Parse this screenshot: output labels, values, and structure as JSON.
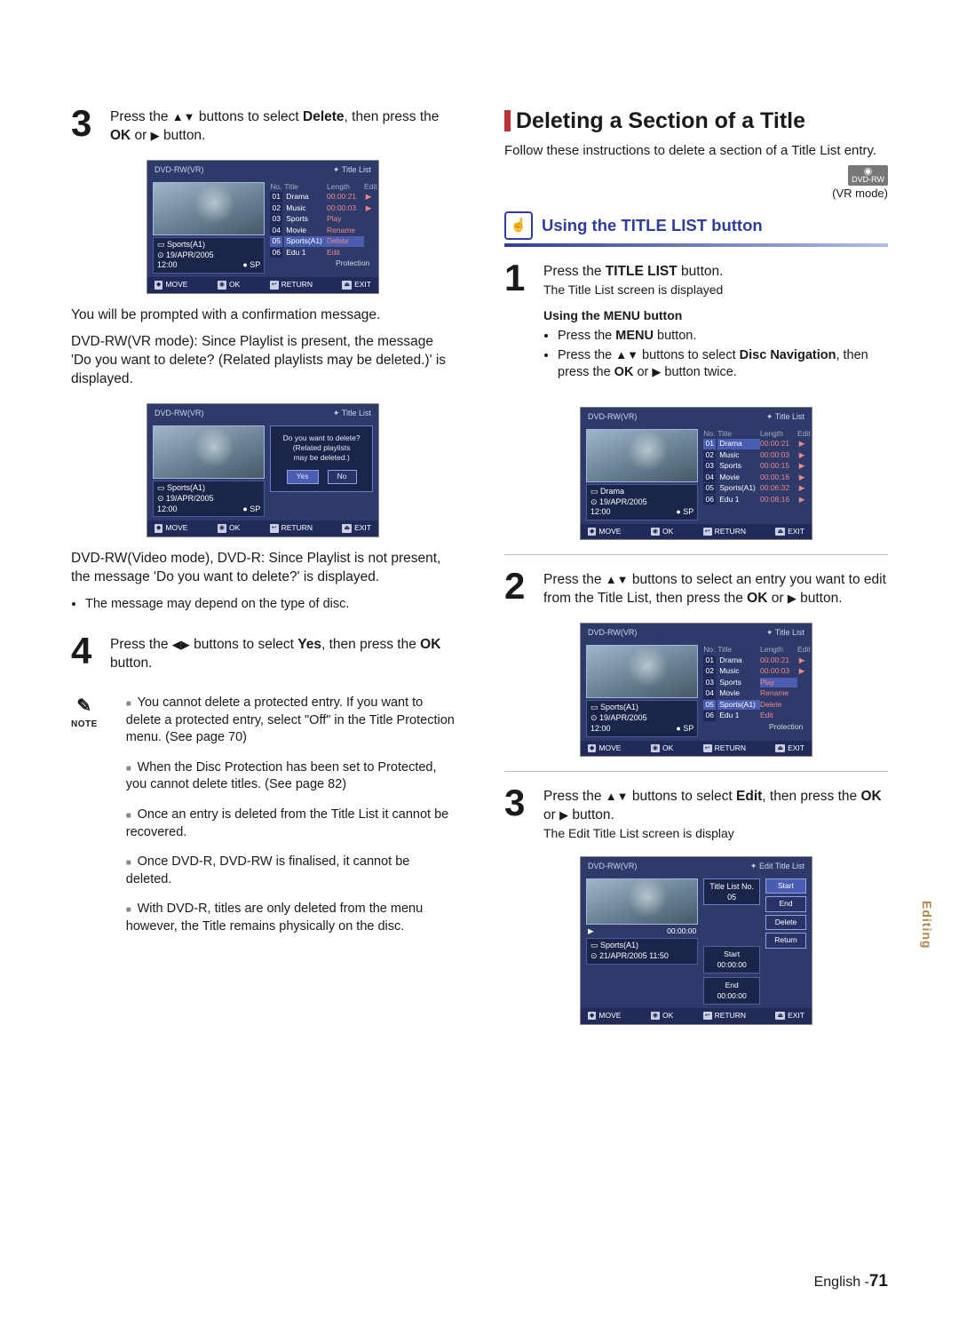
{
  "left": {
    "step3": {
      "text_a": "Press the ",
      "text_b": " buttons to select ",
      "text_bold": "Delete",
      "text_c": ", then press the ",
      "text_bold2": "OK",
      "text_d": " or ",
      "text_e": " button."
    },
    "osd1": {
      "disc": "DVD-RW(VR)",
      "title": "Title List",
      "info_name": "Sports(A1)",
      "info_date": "19/APR/2005",
      "info_time": "12:00",
      "info_sp": "SP",
      "head_no": "No.",
      "head_title": "Title",
      "head_length": "Length",
      "head_edit": "Edit",
      "rows": [
        {
          "no": "01",
          "title": "Drama",
          "len": "00:00:21",
          "edit": "▶"
        },
        {
          "no": "02",
          "title": "Music",
          "len": "00:00:03",
          "edit": "▶"
        },
        {
          "no": "03",
          "title": "Sports",
          "len": "Play",
          "edit": ""
        },
        {
          "no": "04",
          "title": "Movie",
          "len": "Rename",
          "edit": ""
        },
        {
          "no": "05",
          "title": "Sports(A1)",
          "len": "Delete",
          "edit": "",
          "sel": true,
          "lensel": true
        },
        {
          "no": "06",
          "title": "Edu 1",
          "len": "Edit",
          "edit": ""
        }
      ],
      "extra_row": "Protection",
      "footer": {
        "move": "MOVE",
        "ok": "OK",
        "return": "RETURN",
        "exit": "EXIT"
      }
    },
    "para_confirm": "You will be prompted with a confirmation message.",
    "para_vr": "DVD-RW(VR mode): Since Playlist is present, the message 'Do you want to delete? (Related playlists may be deleted.)' is displayed.",
    "osd2": {
      "disc": "DVD-RW(VR)",
      "title": "Title List",
      "info_name": "Sports(A1)",
      "info_date": "19/APR/2005",
      "info_time": "12:00",
      "info_sp": "SP",
      "confirm_line1": "Do you want to delete?",
      "confirm_line2": "(Related playlists",
      "confirm_line3": "may be deleted.)",
      "yes": "Yes",
      "no": "No",
      "footer": {
        "move": "MOVE",
        "ok": "OK",
        "return": "RETURN",
        "exit": "EXIT"
      }
    },
    "para_video": "DVD-RW(Video mode), DVD-R: Since Playlist is not present, the message 'Do you want to delete?' is displayed.",
    "bullet_msg": "The message may depend on the type of disc.",
    "step4": {
      "text_a": "Press the ",
      "text_b": " buttons to select ",
      "text_bold": "Yes",
      "text_c": ", then press the ",
      "text_bold2": "OK",
      "text_d": " button."
    },
    "note_label": "NOTE",
    "notes": [
      "You cannot delete a protected entry. If you want to delete a protected entry, select \"Off\" in the Title Protection menu. (See page 70)",
      "When the Disc Protection has been set to Protected, you cannot delete titles. (See page 82)",
      "Once an entry is deleted from the Title List it cannot be recovered.",
      "Once DVD-R, DVD-RW is finalised, it cannot be deleted.",
      "With DVD-R, titles are only deleted from the menu however, the Title remains physically on the disc."
    ]
  },
  "right": {
    "heading": "Deleting a Section of a Title",
    "sub": "Follow these instructions to delete a section of a Title List entry.",
    "mode_label": "DVD-RW",
    "mode_sub": "(VR mode)",
    "method_title": "Using the TITLE LIST button",
    "step1": {
      "text_a": "Press the ",
      "text_bold": "TITLE LIST",
      "text_b": " button.",
      "sub": "The Title List screen is displayed"
    },
    "menu_heading": "Using the MENU button",
    "menu_b1_a": "Press the ",
    "menu_b1_bold": "MENU",
    "menu_b1_b": " button.",
    "menu_b2_a": "Press the ",
    "menu_b2_b": " buttons to select ",
    "menu_b2_bold": "Disc Navigation",
    "menu_b2_c": ", then press the ",
    "menu_b2_bold2": "OK",
    "menu_b2_d": " or ",
    "menu_b2_e": " button twice.",
    "osd1": {
      "disc": "DVD-RW(VR)",
      "title": "Title List",
      "info_name": "Drama",
      "info_date": "19/APR/2005",
      "info_time": "12:00",
      "info_sp": "SP",
      "head_no": "No.",
      "head_title": "Title",
      "head_length": "Length",
      "head_edit": "Edit",
      "rows": [
        {
          "no": "01",
          "title": "Drama",
          "len": "00:00:21",
          "edit": "▶",
          "sel": true
        },
        {
          "no": "02",
          "title": "Music",
          "len": "00:00:03",
          "edit": "▶"
        },
        {
          "no": "03",
          "title": "Sports",
          "len": "00:00:15",
          "edit": "▶"
        },
        {
          "no": "04",
          "title": "Movie",
          "len": "00:00:16",
          "edit": "▶"
        },
        {
          "no": "05",
          "title": "Sports(A1)",
          "len": "00:06:32",
          "edit": "▶"
        },
        {
          "no": "06",
          "title": "Edu 1",
          "len": "00:08:16",
          "edit": "▶"
        }
      ],
      "footer": {
        "move": "MOVE",
        "ok": "OK",
        "return": "RETURN",
        "exit": "EXIT"
      }
    },
    "step2": {
      "text_a": "Press the ",
      "text_b": " buttons to select an entry you want to edit from the Title List, then press the ",
      "text_bold": "OK",
      "text_c": " or ",
      "text_d": " button."
    },
    "osd2": {
      "disc": "DVD-RW(VR)",
      "title": "Title List",
      "info_name": "Sports(A1)",
      "info_date": "19/APR/2005",
      "info_time": "12:00",
      "info_sp": "SP",
      "head_no": "No.",
      "head_title": "Title",
      "head_length": "Length",
      "head_edit": "Edit",
      "rows": [
        {
          "no": "01",
          "title": "Drama",
          "len": "00:00:21",
          "edit": "▶"
        },
        {
          "no": "02",
          "title": "Music",
          "len": "00:00:03",
          "edit": "▶"
        },
        {
          "no": "03",
          "title": "Sports",
          "len": "Play",
          "edit": "",
          "lensel": true
        },
        {
          "no": "04",
          "title": "Movie",
          "len": "Rename",
          "edit": ""
        },
        {
          "no": "05",
          "title": "Sports(A1)",
          "len": "Delete",
          "edit": "",
          "sel": true
        },
        {
          "no": "06",
          "title": "Edu 1",
          "len": "Edit",
          "edit": ""
        }
      ],
      "extra_row": "Protection",
      "footer": {
        "move": "MOVE",
        "ok": "OK",
        "return": "RETURN",
        "exit": "EXIT"
      }
    },
    "step3": {
      "text_a": "Press the ",
      "text_b": " buttons to select ",
      "text_bold": "Edit",
      "text_c": ", then press the ",
      "text_bold2": "OK",
      "text_d": " or ",
      "text_e": " button.",
      "sub": "The Edit Title List screen is display"
    },
    "osd3": {
      "disc": "DVD-RW(VR)",
      "title": "Edit Title List",
      "titlebar": "Title List No. 05",
      "info_name": "Sports(A1)",
      "info_date": "21/APR/2005 11:50",
      "play_time": "00:00:00",
      "start_label": "Start",
      "start_val": "00:00:00",
      "end_label": "End",
      "end_val": "00:00:00",
      "btn_start": "Start",
      "btn_end": "End",
      "btn_delete": "Delete",
      "btn_return": "Return",
      "footer": {
        "move": "MOVE",
        "ok": "OK",
        "return": "RETURN",
        "exit": "EXIT"
      }
    }
  },
  "side_tab": "Editing",
  "footer_lang": "English -",
  "footer_page": "71"
}
